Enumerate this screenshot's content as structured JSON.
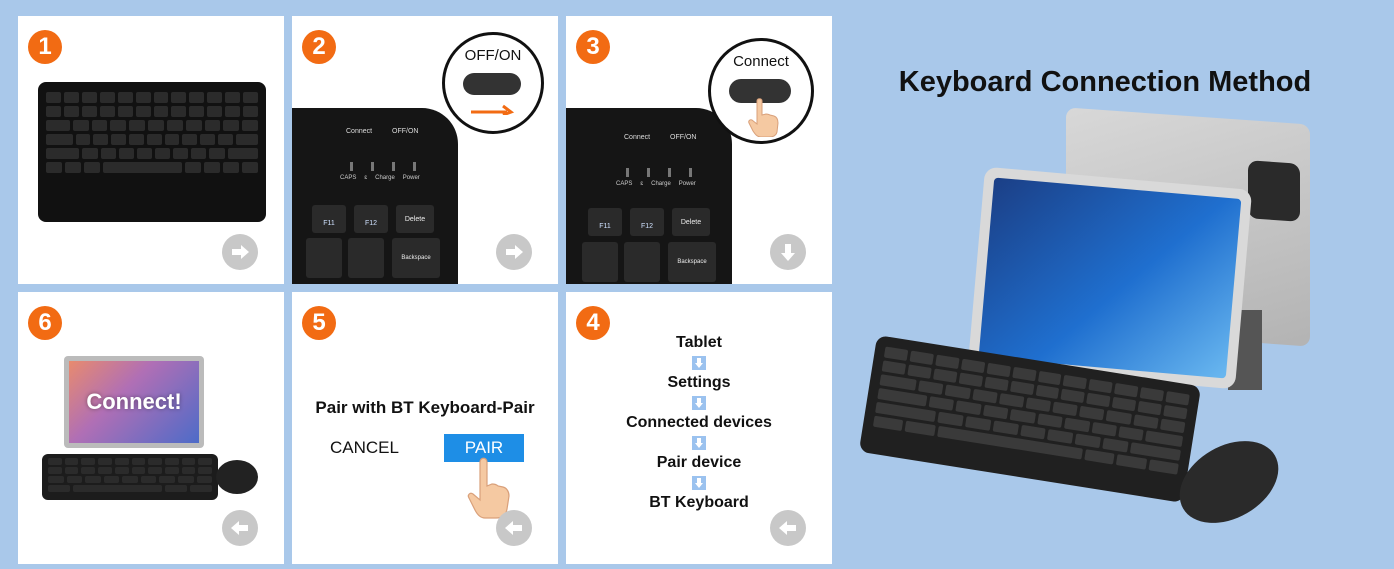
{
  "title": "Keyboard Connection Method",
  "steps": {
    "s1": {
      "num": "1"
    },
    "s2": {
      "num": "2",
      "switch_label": "OFF/ON",
      "connect_label": "Connect",
      "offon_small": "OFF/ON",
      "caps": "CAPS",
      "charge": "Charge",
      "power": "Power",
      "f11": "F11",
      "f12": "F12",
      "delete": "Delete",
      "backspace": "Backspace"
    },
    "s3": {
      "num": "3",
      "bubble_label": "Connect",
      "connect_label": "Connect",
      "offon_small": "OFF/ON",
      "caps": "CAPS",
      "charge": "Charge",
      "power": "Power",
      "f11": "F11",
      "f12": "F12",
      "delete": "Delete",
      "backspace": "Backspace"
    },
    "s4": {
      "num": "4",
      "flow": [
        "Tablet",
        "Settings",
        "Connected devices",
        "Pair device",
        "BT Keyboard"
      ]
    },
    "s5": {
      "num": "5",
      "prompt": "Pair with BT Keyboard-Pair",
      "cancel": "CANCEL",
      "pair": "PAIR"
    },
    "s6": {
      "num": "6",
      "screen_text": "Connect!"
    }
  },
  "colors": {
    "accent": "#f26b13",
    "background": "#a9c8ea",
    "pair_button": "#1e8ee6"
  }
}
